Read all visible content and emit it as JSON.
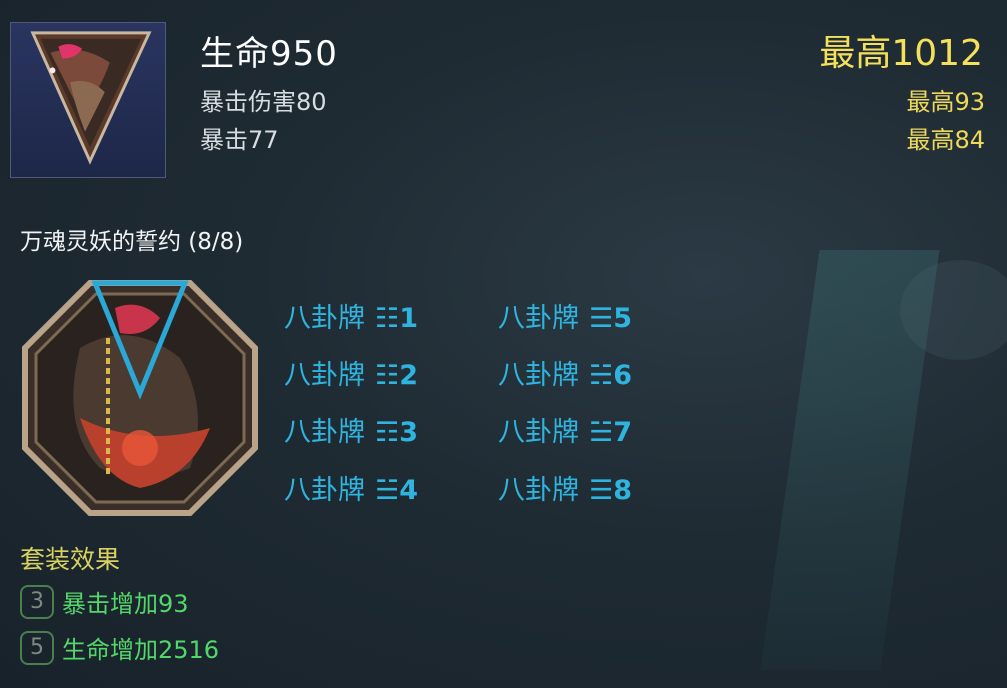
{
  "item": {
    "icon": "triangle-shard-icon"
  },
  "stats": {
    "main": "生命950",
    "sub1": "暴击伤害80",
    "sub2": "暴击77"
  },
  "max_stats": {
    "main": "最高1012",
    "sub1": "最高93",
    "sub2": "最高84"
  },
  "set": {
    "name": "万魂灵妖的誓约 (8/8)",
    "emblem": "octagon-set-emblem-icon",
    "pieces": [
      {
        "label": "八卦牌",
        "code": "☷1"
      },
      {
        "label": "八卦牌",
        "code": "☷2"
      },
      {
        "label": "八卦牌",
        "code": "☶3"
      },
      {
        "label": "八卦牌",
        "code": "☱4"
      },
      {
        "label": "八卦牌",
        "code": "☰5"
      },
      {
        "label": "八卦牌",
        "code": "☵6"
      },
      {
        "label": "八卦牌",
        "code": "☱7"
      },
      {
        "label": "八卦牌",
        "code": "☰8"
      }
    ],
    "effects_title": "套装效果",
    "effects": [
      {
        "count": "3",
        "text": "暴击增加93"
      },
      {
        "count": "5",
        "text": "生命增加2516"
      }
    ]
  },
  "colors": {
    "accent_gold": "#f4e05a",
    "piece_blue": "#2fb4e0",
    "effect_green": "#52d86a",
    "title_yellow": "#d9d261"
  }
}
